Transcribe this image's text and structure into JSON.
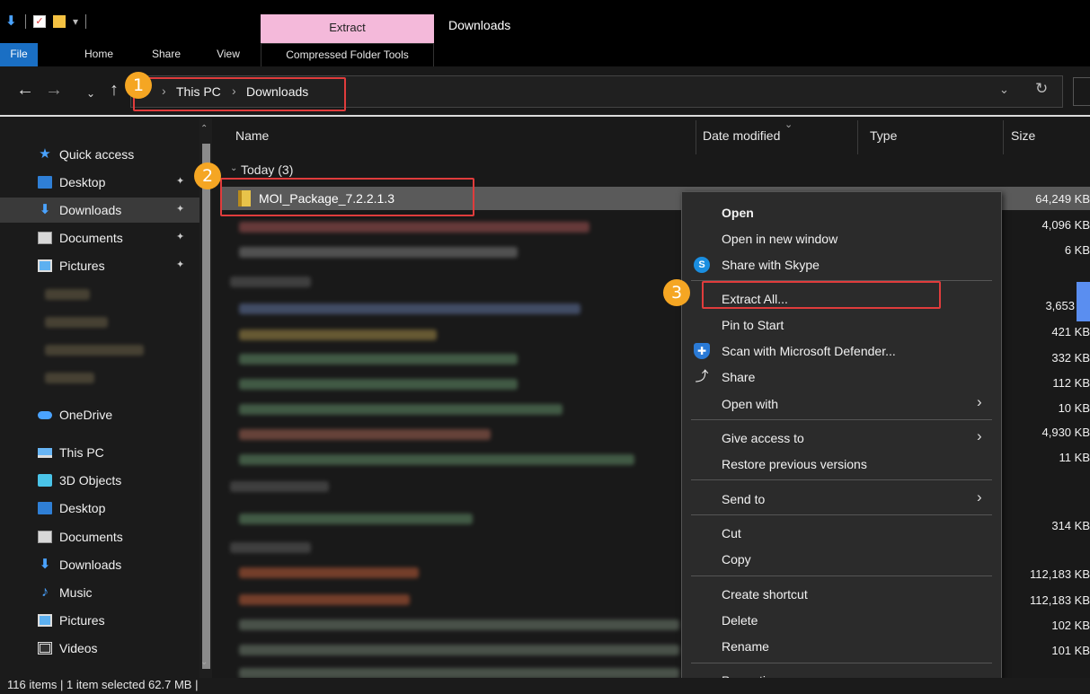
{
  "window": {
    "title": "Downloads",
    "context_tab": "Extract",
    "accent_color": "#1a6fc4",
    "context_tab_color": "#f4b9da"
  },
  "ribbon": {
    "tabs": [
      "File",
      "Home",
      "Share",
      "View",
      "Compressed Folder Tools"
    ]
  },
  "address": {
    "crumbs": [
      "This PC",
      "Downloads"
    ]
  },
  "callouts": [
    "1",
    "2",
    "3"
  ],
  "nav": {
    "quick_access": "Quick access",
    "pinned": [
      "Desktop",
      "Downloads",
      "Documents",
      "Pictures"
    ],
    "onedrive": "OneDrive",
    "this_pc": "This PC",
    "pc_items": [
      "3D Objects",
      "Desktop",
      "Documents",
      "Downloads",
      "Music",
      "Pictures",
      "Videos"
    ]
  },
  "filelist": {
    "columns": [
      "Name",
      "Date modified",
      "Type",
      "Size"
    ],
    "group_today": "Today (3)",
    "selected_file": "MOI_Package_7.2.2.1.3",
    "sizes": [
      "64,249 KB",
      "4,096 KB",
      "6 KB",
      "3,653",
      "421 KB",
      "332 KB",
      "112 KB",
      "10 KB",
      "4,930 KB",
      "11 KB",
      "314 KB",
      "112,183 KB",
      "112,183 KB",
      "102 KB",
      "101 KB"
    ]
  },
  "context_menu": {
    "items": [
      "Open",
      "Open in new window",
      "Share with Skype",
      "Extract All...",
      "Pin to Start",
      "Scan with Microsoft Defender...",
      "Share",
      "Open with",
      "Give access to",
      "Restore previous versions",
      "Send to",
      "Cut",
      "Copy",
      "Create shortcut",
      "Delete",
      "Rename",
      "Properties"
    ]
  },
  "status": {
    "text": "116 items  |  1 item selected  62.7 MB  |"
  }
}
